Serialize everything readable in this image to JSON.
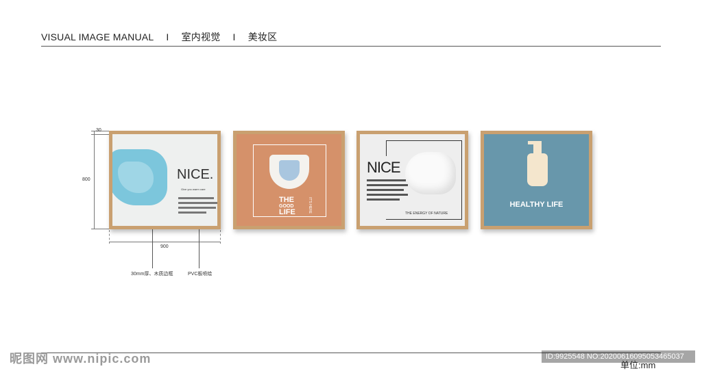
{
  "header": {
    "part1": "VISUAL IMAGE MANUAL",
    "sep": "I",
    "part2": "室内视觉",
    "part3": "美妆区"
  },
  "footer": {
    "unit": "单位:mm",
    "watermark_left": "昵图网 www.nipic.com",
    "watermark_right": "ID:9925548 NO:20200616095053465037"
  },
  "dimensions": {
    "frame_thickness": "30",
    "height": "800",
    "width": "900"
  },
  "callouts": {
    "frame": "30mm厚、木质边框",
    "panel": "PVC板喷绘"
  },
  "panels": [
    {
      "title": "NICE.",
      "subtitle": "Give you warm care"
    },
    {
      "title_line1": "THE",
      "title_line2": "GOOD",
      "title_line3": "LIFE",
      "side_text": "IT'S HERE"
    },
    {
      "title": "NICE",
      "footer": "THE ENERGY OF NATURE"
    },
    {
      "title": "HEALTHY LIFE"
    }
  ],
  "colors": {
    "frame_wood": "#c9a070",
    "panel2_bg": "#d5916a",
    "panel4_bg": "#6897ab"
  }
}
